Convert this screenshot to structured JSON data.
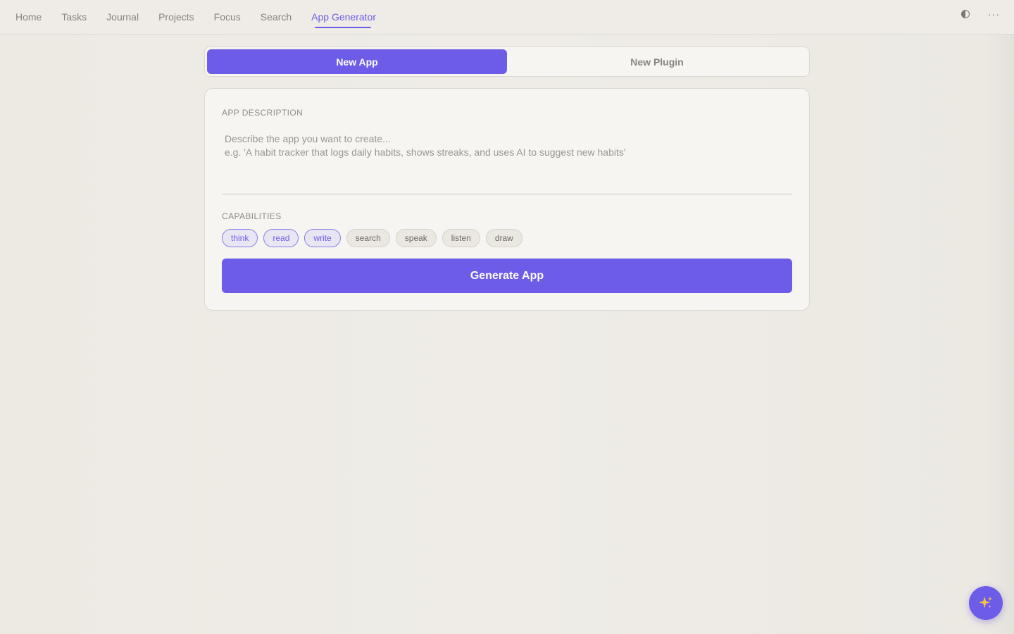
{
  "nav": {
    "items": [
      {
        "label": "Home"
      },
      {
        "label": "Tasks"
      },
      {
        "label": "Journal"
      },
      {
        "label": "Projects"
      },
      {
        "label": "Focus"
      },
      {
        "label": "Search"
      },
      {
        "label": "App Generator",
        "active": true
      }
    ],
    "right_icons": [
      "theme-toggle-icon",
      "more-icon"
    ],
    "more_glyph": "···"
  },
  "mode_toggle": {
    "options": [
      "New App",
      "New Plugin"
    ],
    "selected": "New App"
  },
  "form": {
    "description_label": "APP DESCRIPTION",
    "description_value": "",
    "description_placeholder": "Describe the app you want to create...\ne.g. 'A habit tracker that logs daily habits, shows streaks, and uses AI to suggest new habits'",
    "capabilities_label": "CAPABILITIES",
    "capabilities": [
      {
        "label": "think",
        "selected": true
      },
      {
        "label": "read",
        "selected": true
      },
      {
        "label": "write",
        "selected": true
      },
      {
        "label": "search",
        "selected": false
      },
      {
        "label": "speak",
        "selected": false
      },
      {
        "label": "listen",
        "selected": false
      },
      {
        "label": "draw",
        "selected": false
      }
    ],
    "generate_label": "Generate App"
  },
  "fab": {
    "icon": "sparkle-icon"
  },
  "colors": {
    "accent": "#6c5ce7",
    "background": "#efece7",
    "card": "#f6f5f2"
  }
}
